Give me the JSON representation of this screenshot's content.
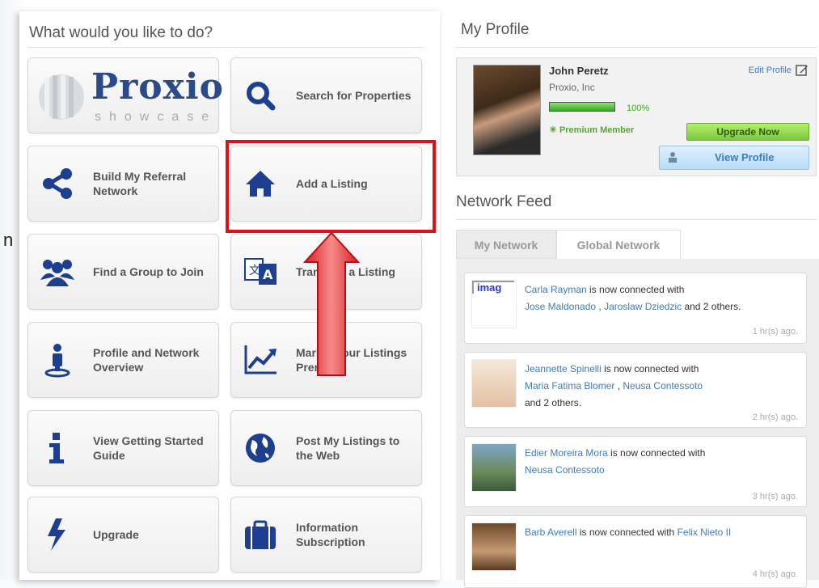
{
  "left": {
    "title": "What would you like to do?",
    "logo": {
      "word": "Proxio",
      "sub": "showcase"
    },
    "tiles": [
      {
        "label": "Search for Properties",
        "icon": "search-icon"
      },
      {
        "label": "Build My Referral Network",
        "icon": "share-icon"
      },
      {
        "label": "Add a Listing",
        "icon": "home-icon"
      },
      {
        "label": "Find a Group to Join",
        "icon": "group-icon"
      },
      {
        "label": "Translate a Listing",
        "icon": "translate-icon"
      },
      {
        "label": "Profile and Network Overview",
        "icon": "user-pin-icon"
      },
      {
        "label": "Market Your Listings Premium",
        "icon": "chart-line-icon"
      },
      {
        "label": "View Getting Started Guide",
        "icon": "info-icon"
      },
      {
        "label": "Post My Listings to the Web",
        "icon": "globe-icon"
      },
      {
        "label": "Upgrade",
        "icon": "lightning-icon"
      },
      {
        "label": "Information Subscription",
        "icon": "briefcase-icon"
      }
    ],
    "edge_char": "n"
  },
  "profile": {
    "title": "My Profile",
    "name": "John Peretz",
    "company": "Proxio, Inc",
    "progress_label": "100%",
    "progress_value": 1.0,
    "status": "Premium Member",
    "edit_label": "Edit Profile",
    "upgrade_label": "Upgrade Now",
    "view_label": "View Profile"
  },
  "feed": {
    "title": "Network Feed",
    "tabs": [
      "My Network",
      "Global Network"
    ],
    "items": [
      {
        "actor": "Carla Rayman",
        "text": " is now connected with",
        "targets": [
          "Jose Maldonado",
          "Jaroslaw Dziedzic"
        ],
        "others": " and 2 others.",
        "time": "1 hr(s) ago.",
        "thumb_text": "imag"
      },
      {
        "actor": "Jeannette Spinelli",
        "text": " is now connected with",
        "targets": [
          "Maria Fatima Blomer",
          "Neusa Contessoto"
        ],
        "others": "and 2 others.",
        "time": "2 hr(s) ago."
      },
      {
        "actor": "Edier Moreira Mora",
        "text": " is now connected with",
        "targets": [
          "Neusa Contessoto"
        ],
        "others": "",
        "time": "3 hr(s) ago."
      },
      {
        "actor": "Barb Averell",
        "text": " is now connected with ",
        "targets": [
          "Felix Nieto II"
        ],
        "others": "",
        "time": "4 hr(s) ago."
      }
    ]
  },
  "colors": {
    "accent": "#3d7cc0",
    "highlight": "#e0101a",
    "logo": "#2a4a8a"
  }
}
